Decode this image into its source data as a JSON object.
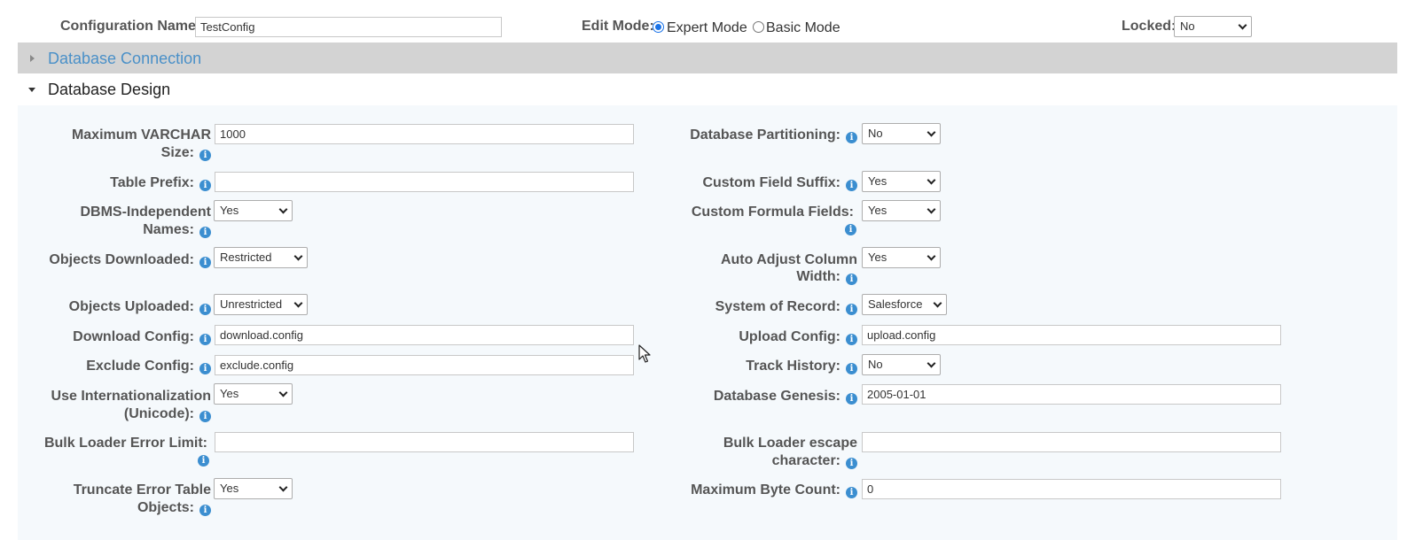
{
  "top": {
    "config_name_label": "Configuration Name:",
    "config_name_value": "TestConfig",
    "edit_mode_label": "Edit Mode:",
    "expert_mode_label": "Expert Mode",
    "basic_mode_label": "Basic Mode",
    "edit_mode_selected": "Expert Mode",
    "locked_label": "Locked:",
    "locked_value": "No"
  },
  "sections": {
    "db_connection": "Database Connection",
    "db_design": "Database Design"
  },
  "form": {
    "max_varchar_l1": "Maximum VARCHAR",
    "max_varchar_l2": "Size:",
    "max_varchar_value": "1000",
    "table_prefix": "Table Prefix:",
    "table_prefix_value": "",
    "dbms_l1": "DBMS-Independent",
    "dbms_l2": "Names:",
    "dbms_value": "Yes",
    "objects_downloaded": "Objects Downloaded:",
    "objects_downloaded_value": "Restricted",
    "objects_uploaded": "Objects Uploaded:",
    "objects_uploaded_value": "Unrestricted",
    "download_config": "Download Config:",
    "download_config_value": "download.config",
    "exclude_config": "Exclude Config:",
    "exclude_config_value": "exclude.config",
    "intl_l1": "Use Internationalization",
    "intl_l2": "(Unicode):",
    "intl_value": "Yes",
    "bulk_error_l1": "Bulk Loader Error Limit:",
    "bulk_error_value": "",
    "truncate_l1": "Truncate Error Table",
    "truncate_l2": "Objects:",
    "truncate_value": "Yes",
    "db_partitioning": "Database Partitioning:",
    "db_partitioning_value": "No",
    "custom_field_suffix": "Custom Field Suffix:",
    "custom_field_suffix_value": "Yes",
    "custom_formula": "Custom Formula Fields:",
    "custom_formula_value": "Yes",
    "auto_adjust_l1": "Auto Adjust Column",
    "auto_adjust_l2": "Width:",
    "auto_adjust_value": "Yes",
    "system_of_record": "System of Record:",
    "system_of_record_value": "Salesforce",
    "upload_config": "Upload Config:",
    "upload_config_value": "upload.config",
    "track_history": "Track History:",
    "track_history_value": "No",
    "db_genesis": "Database Genesis:",
    "db_genesis_value": "2005-01-01",
    "bulk_escape_l1": "Bulk Loader escape",
    "bulk_escape_l2": "character:",
    "bulk_escape_value": "",
    "max_byte": "Maximum Byte Count:",
    "max_byte_value": "0"
  },
  "colors": {
    "accent": "#3b8ed0",
    "link": "#4a90c8",
    "collapsed_header": "#d3d3d3",
    "panel_bg": "#f5f9fc"
  },
  "icons": {
    "info": "info-icon",
    "caret_right": "caret-right-icon",
    "caret_down": "caret-down-icon",
    "select_arrow": "chevron-down-icon",
    "cursor": "mouse-pointer-icon"
  }
}
